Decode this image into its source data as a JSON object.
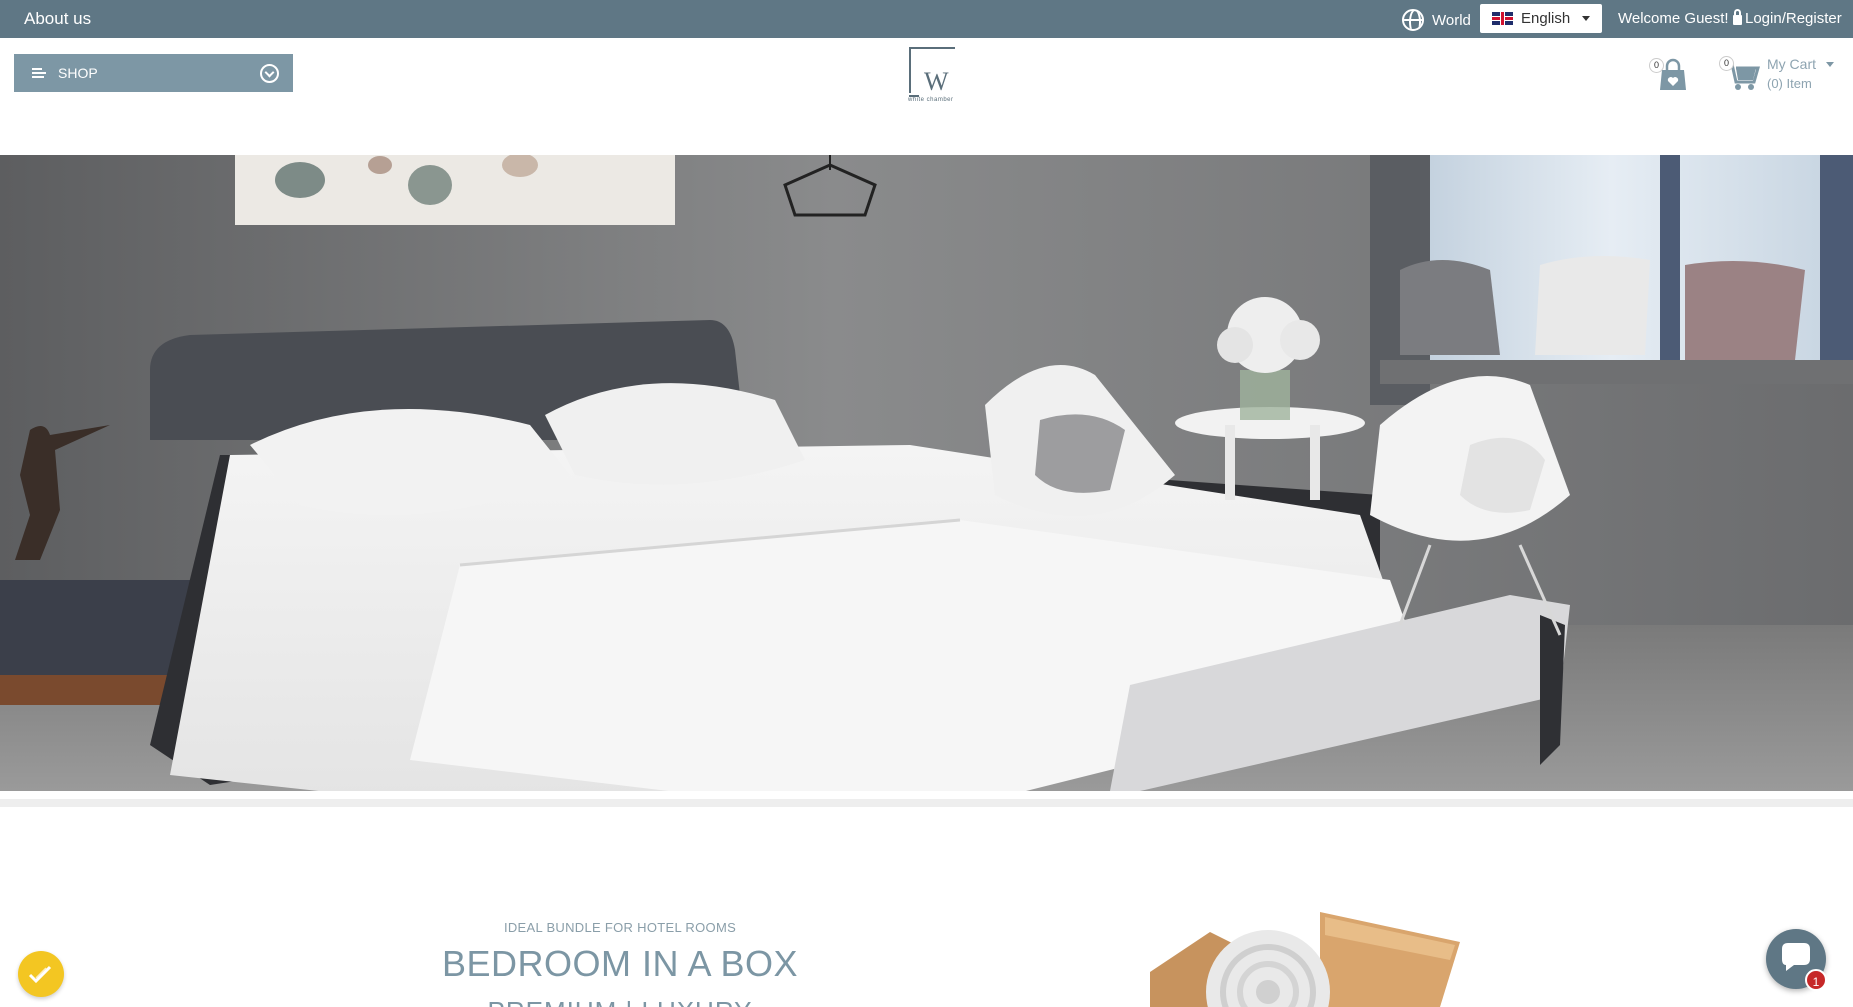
{
  "topbar": {
    "about": "About us",
    "region": "World",
    "language": "English",
    "welcome": "Welcome Guest!",
    "login": "Login/Register"
  },
  "header": {
    "shop_label": "SHOP",
    "logo_text": "W",
    "logo_subtext": "white chamber",
    "wishlist_count": "0",
    "cart_count_badge": "0",
    "cart_label": "My Cart",
    "cart_items": "(0) Item"
  },
  "promo": {
    "subtitle": "IDEAL BUNDLE FOR HOTEL ROOMS",
    "title": "BEDROOM IN A BOX",
    "tagline": "PREMIUM  |  LUXURY"
  },
  "chat": {
    "badge": "1"
  },
  "colors": {
    "topbar": "#5f7785",
    "accent": "#7d97a5",
    "title": "#7c96a4",
    "accept_button": "#f3c622",
    "chat_badge": "#c62828"
  }
}
